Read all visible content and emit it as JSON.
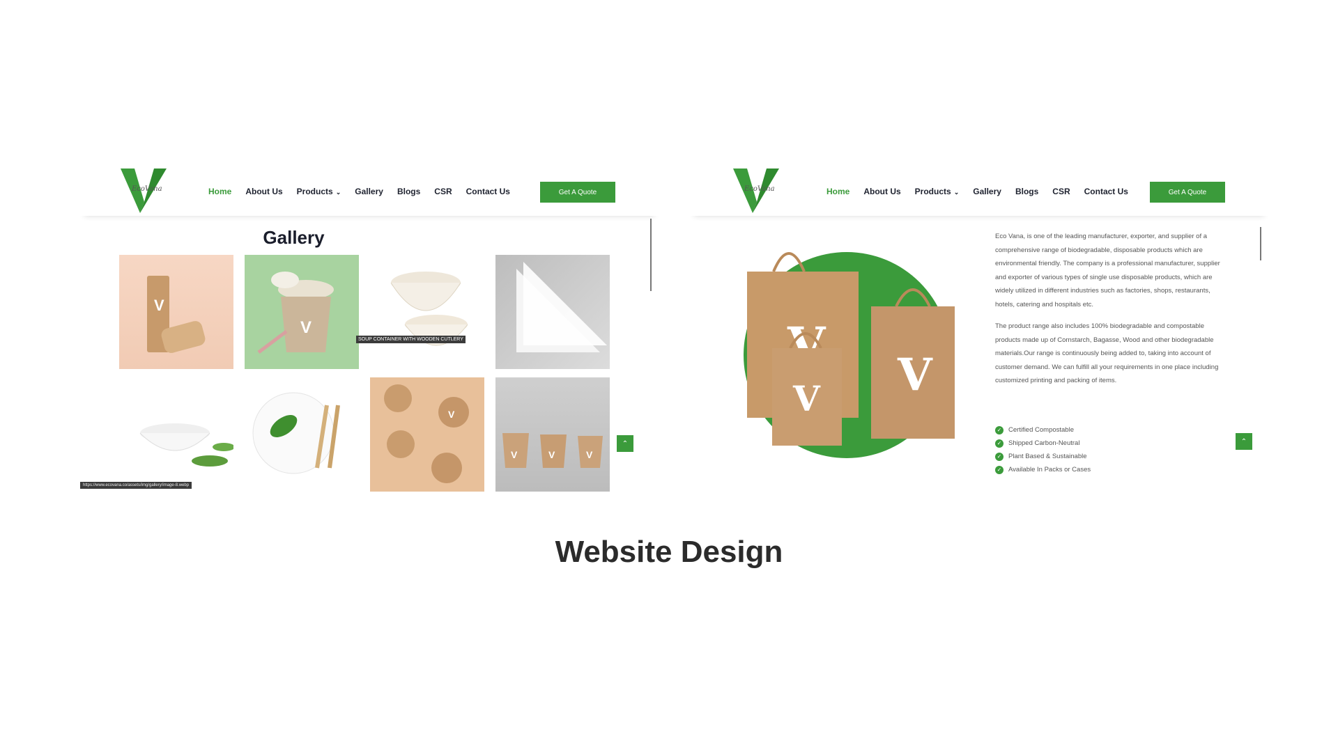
{
  "nav": {
    "items": [
      "Home",
      "About Us",
      "Products",
      "Gallery",
      "Blogs",
      "CSR",
      "Contact Us"
    ],
    "products_chevron": "⌄",
    "quote_button": "Get A Quote"
  },
  "gallery": {
    "title": "Gallery",
    "hover_caption": "SOUP CONTAINER WITH WOODEN CUTLERY",
    "status_url": "https://www.ecovana.co/assets/img/gallery/image-8.webp"
  },
  "about": {
    "paragraphs": [
      "Eco Vana, is one of the leading manufacturer, exporter, and supplier of a comprehensive range of biodegradable, disposable products which are environmental friendly. The company is a professional manufacturer, supplier and exporter of various types of single use disposable products, which are widely utilized in different industries such as factories, shops, restaurants, hotels, catering and hospitals etc.",
      "The product range also includes 100% biodegradable and compostable products made up of Cornstarch, Bagasse, Wood and other biodegradable materials.Our range is continuously being added to, taking into account of customer demand. We can fulfill all your requirements in one place including customized printing and packing of items."
    ],
    "features": [
      "Certified Compostable",
      "Shipped Carbon-Neutral",
      "Plant Based & Sustainable",
      "Available In Packs or Cases"
    ]
  },
  "page_title": "Website Design",
  "colors": {
    "accent": "#3b9b3b",
    "nav_text": "#1f2330"
  },
  "icons": {
    "scroll_top": "chevron-up-icon",
    "check": "check-circle-icon"
  }
}
